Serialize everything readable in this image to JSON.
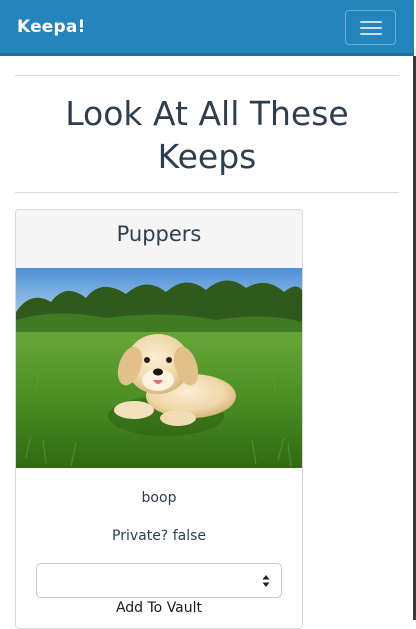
{
  "navbar": {
    "brand": "Keepa!",
    "menu_toggle_icon": "hamburger-icon",
    "background_color": "#2485bd"
  },
  "page": {
    "title": "Look At All These Keeps"
  },
  "keeps": [
    {
      "name": "Puppers",
      "image": "golden-retriever-puppy-lying-in-grass",
      "description": "boop",
      "private_text": "Private? false",
      "vault_select": {
        "selected_value": ""
      },
      "add_to_vault_label": "Add To Vault"
    }
  ]
}
